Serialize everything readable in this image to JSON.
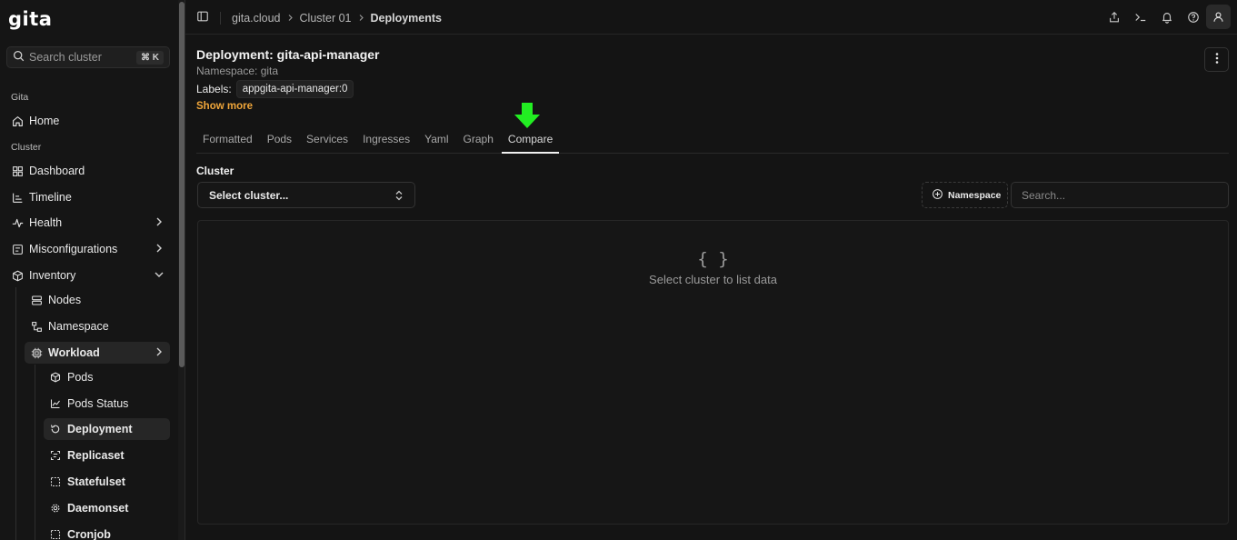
{
  "app": {
    "logo": "gita"
  },
  "sidebar": {
    "search_placeholder": "Search cluster",
    "search_shortcut": "⌘ K",
    "sections": {
      "gita": "Gita",
      "cluster": "Cluster"
    },
    "items": {
      "home": "Home",
      "dashboard": "Dashboard",
      "timeline": "Timeline",
      "health": "Health",
      "misconfigurations": "Misconfigurations",
      "inventory": "Inventory",
      "nodes": "Nodes",
      "namespace": "Namespace",
      "workload": "Workload",
      "pods": "Pods",
      "pods_status": "Pods Status",
      "deployment": "Deployment",
      "replicaset": "Replicaset",
      "statefulset": "Statefulset",
      "daemonset": "Daemonset",
      "cronjob": "Cronjob"
    }
  },
  "breadcrumb": [
    "gita.cloud",
    "Cluster 01",
    "Deployments"
  ],
  "page": {
    "title": "Deployment: gita-api-manager",
    "namespace": "Namespace: gita",
    "labels_label": "Labels:",
    "label_chip": "appgita-api-manager:0",
    "show_more": "Show more"
  },
  "tabs": [
    "Formatted",
    "Pods",
    "Services",
    "Ingresses",
    "Yaml",
    "Graph",
    "Compare"
  ],
  "active_tab": "Compare",
  "compare": {
    "cluster_label": "Cluster",
    "select_placeholder": "Select cluster...",
    "namespace_button": "Namespace",
    "search_placeholder": "Search...",
    "empty_icon": "{ }",
    "empty_text": "Select cluster to list data"
  },
  "colors": {
    "accent": "#f0a63a",
    "pointer_arrow": "#22ee22",
    "background": "#141414"
  },
  "icons": {
    "topbar": [
      "panel-toggle-icon",
      "share-icon",
      "terminal-icon",
      "bell-icon",
      "help-icon",
      "user-icon"
    ]
  }
}
